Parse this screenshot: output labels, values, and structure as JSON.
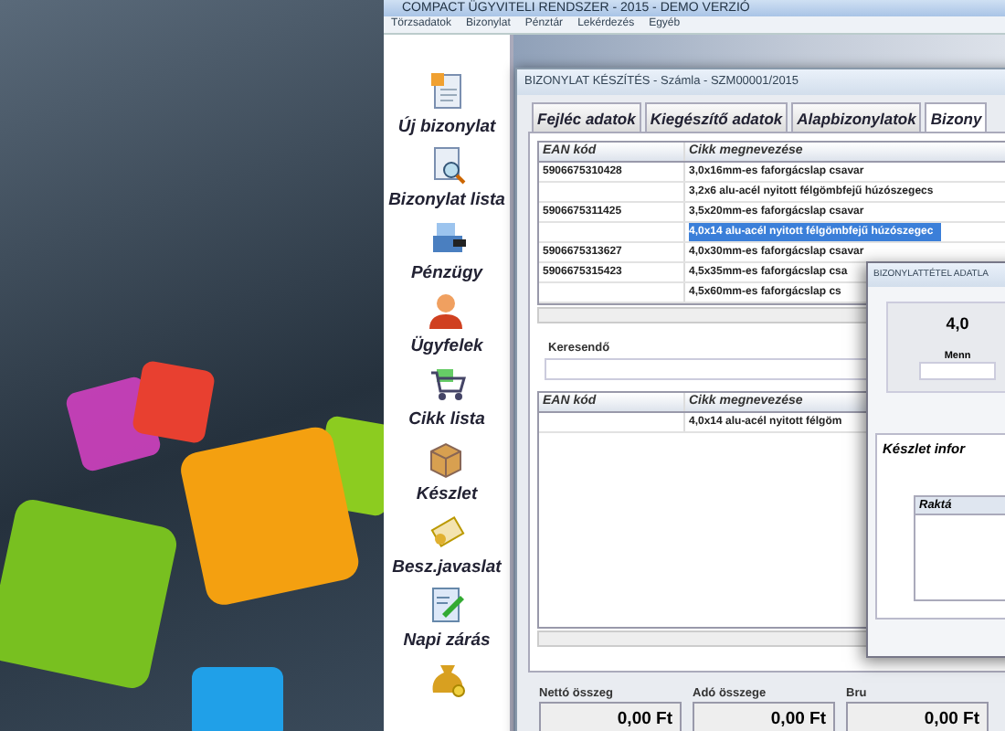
{
  "app_window": {
    "title": "COMPACT ÜGYVITELI RENDSZER - 2015 - DEMO VERZIÓ",
    "menu": [
      "Törzsadatok",
      "Bizonylat",
      "Pénztár",
      "Lekérdezés",
      "Egyéb"
    ]
  },
  "sidebar": {
    "items": [
      {
        "label": "Új bizonylat",
        "kind": "document"
      },
      {
        "label": "Bizonylat lista",
        "kind": "search"
      },
      {
        "label": "Pénzügy",
        "kind": "register"
      },
      {
        "label": "Ügyfelek",
        "kind": "person"
      },
      {
        "label": "Cikk lista",
        "kind": "cart"
      },
      {
        "label": "Készlet",
        "kind": "box"
      },
      {
        "label": "Besz.javaslat",
        "kind": "scroll"
      },
      {
        "label": "Napi zárás",
        "kind": "notepad"
      },
      {
        "kind": "moneybag"
      }
    ]
  },
  "document_window": {
    "title": "BIZONYLAT KÉSZÍTÉS - Számla - SZM00001/2015",
    "tabs": [
      {
        "label": "Fejléc adatok",
        "selected": false
      },
      {
        "label": "Kiegészítő adatok",
        "selected": false
      },
      {
        "label": "Alapbizonylatok",
        "selected": false
      },
      {
        "label": "Bizony",
        "selected": true
      }
    ],
    "items_table": {
      "columns": [
        "EAN kód",
        "Cikk megnevezése"
      ],
      "rows": [
        {
          "cells": [
            "5906675310428",
            "3,0x16mm-es faforgácslap csavar"
          ],
          "selected": false
        },
        {
          "cells": [
            "",
            "3,2x6 alu-acél nyitott félgömbfejű húzószegecs"
          ],
          "selected": false
        },
        {
          "cells": [
            "5906675311425",
            "3,5x20mm-es faforgácslap csavar"
          ],
          "selected": false
        },
        {
          "cells": [
            "",
            "4,0x14 alu-acél nyitott félgömbfejű húzószegec"
          ],
          "selected": true
        },
        {
          "cells": [
            "5906675313627",
            "4,0x30mm-es faforgácslap csavar"
          ],
          "selected": false
        },
        {
          "cells": [
            "5906675315423",
            "4,5x35mm-es faforgácslap csa"
          ],
          "selected": false
        },
        {
          "cells": [
            "",
            "4,5x60mm-es faforgácslap cs"
          ],
          "selected": false
        }
      ]
    },
    "search": {
      "label": "Keresendő"
    },
    "result_table": {
      "columns": [
        "EAN kód",
        "Cikk megnevezése"
      ],
      "rows": [
        {
          "cells": [
            "",
            "4,0x14 alu-acél nyitott félgöm"
          ],
          "selected": false
        }
      ]
    },
    "totals": [
      {
        "label": "Nettó összeg",
        "value": "0,00 Ft"
      },
      {
        "label": "Adó összege",
        "value": "0,00 Ft"
      },
      {
        "label": "Bru",
        "value": "0,00 Ft"
      }
    ]
  },
  "item_dialog": {
    "title": "BIZONYLATTÉTEL ADATLA",
    "item_name": "4,0",
    "quantity_label": "Menn",
    "stock_section": "Készlet infor",
    "stock_columns": [
      "Raktá"
    ]
  }
}
